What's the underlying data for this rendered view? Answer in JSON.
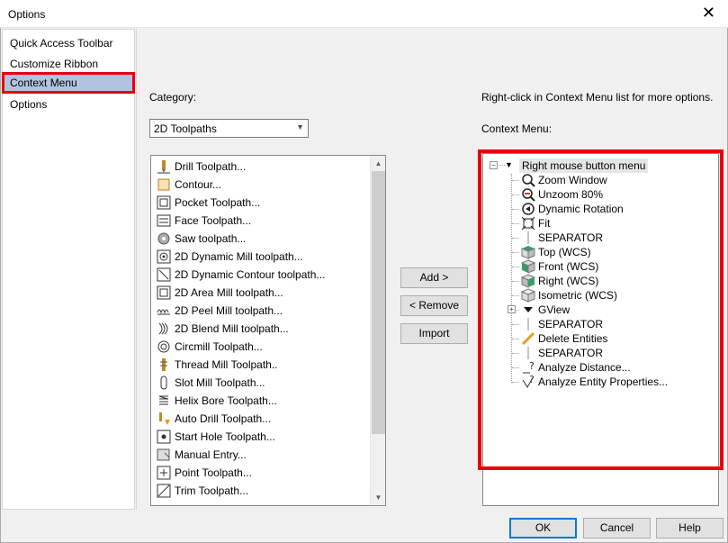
{
  "window": {
    "title": "Options"
  },
  "nav": {
    "items": [
      {
        "label": "Quick Access Toolbar"
      },
      {
        "label": "Customize Ribbon"
      },
      {
        "label": "Context Menu"
      },
      {
        "label": "Options"
      }
    ]
  },
  "category": {
    "label": "Category:",
    "selected": "2D Toolpaths"
  },
  "commands": [
    {
      "label": "Drill Toolpath...",
      "icon": "drill-icon"
    },
    {
      "label": "Contour...",
      "icon": "contour-icon"
    },
    {
      "label": "Pocket Toolpath...",
      "icon": "pocket-icon"
    },
    {
      "label": "Face Toolpath...",
      "icon": "face-icon"
    },
    {
      "label": "Saw toolpath...",
      "icon": "saw-icon"
    },
    {
      "label": "2D Dynamic Mill toolpath...",
      "icon": "dynamic-mill-icon"
    },
    {
      "label": "2D Dynamic Contour toolpath...",
      "icon": "dynamic-contour-icon"
    },
    {
      "label": "2D Area Mill toolpath...",
      "icon": "area-mill-icon"
    },
    {
      "label": "2D Peel Mill toolpath...",
      "icon": "peel-mill-icon"
    },
    {
      "label": "2D Blend Mill toolpath...",
      "icon": "blend-mill-icon"
    },
    {
      "label": "Circmill Toolpath...",
      "icon": "circmill-icon"
    },
    {
      "label": "Thread Mill Toolpath..",
      "icon": "thread-mill-icon"
    },
    {
      "label": "Slot Mill Toolpath...",
      "icon": "slot-mill-icon"
    },
    {
      "label": "Helix Bore Toolpath...",
      "icon": "helix-bore-icon"
    },
    {
      "label": "Auto Drill Toolpath...",
      "icon": "auto-drill-icon"
    },
    {
      "label": "Start Hole Toolpath...",
      "icon": "start-hole-icon"
    },
    {
      "label": "Manual Entry...",
      "icon": "manual-entry-icon"
    },
    {
      "label": "Point Toolpath...",
      "icon": "point-icon"
    },
    {
      "label": "Trim Toolpath...",
      "icon": "trim-icon"
    }
  ],
  "buttons": {
    "add": "Add >",
    "remove": "< Remove",
    "import": "Import",
    "ok": "OK",
    "cancel": "Cancel",
    "help": "Help"
  },
  "context": {
    "hint": "Right-click in Context Menu list for more options.",
    "label": "Context Menu:",
    "root": "Right mouse button menu",
    "items": [
      {
        "label": "Zoom Window",
        "icon": "zoom-window-icon"
      },
      {
        "label": "Unzoom 80%",
        "icon": "unzoom-icon"
      },
      {
        "label": "Dynamic Rotation",
        "icon": "rotation-icon"
      },
      {
        "label": "Fit",
        "icon": "fit-icon"
      },
      {
        "label": "SEPARATOR",
        "icon": "separator-icon"
      },
      {
        "label": "Top (WCS)",
        "icon": "cube-top-icon"
      },
      {
        "label": "Front (WCS)",
        "icon": "cube-front-icon"
      },
      {
        "label": "Right (WCS)",
        "icon": "cube-right-icon"
      },
      {
        "label": "Isometric (WCS)",
        "icon": "cube-iso-icon"
      },
      {
        "label": "GView",
        "icon": "submenu-arrow-icon"
      },
      {
        "label": "SEPARATOR",
        "icon": "separator-icon"
      },
      {
        "label": "Delete Entities",
        "icon": "delete-entities-icon"
      },
      {
        "label": "SEPARATOR",
        "icon": "separator-icon"
      },
      {
        "label": "Analyze Distance...",
        "icon": "analyze-distance-icon"
      },
      {
        "label": "Analyze Entity Properties...",
        "icon": "analyze-entity-icon"
      }
    ]
  },
  "colors": {
    "highlight": "#e8000d",
    "selection": "#b0c4de",
    "accent": "#0078d7"
  }
}
